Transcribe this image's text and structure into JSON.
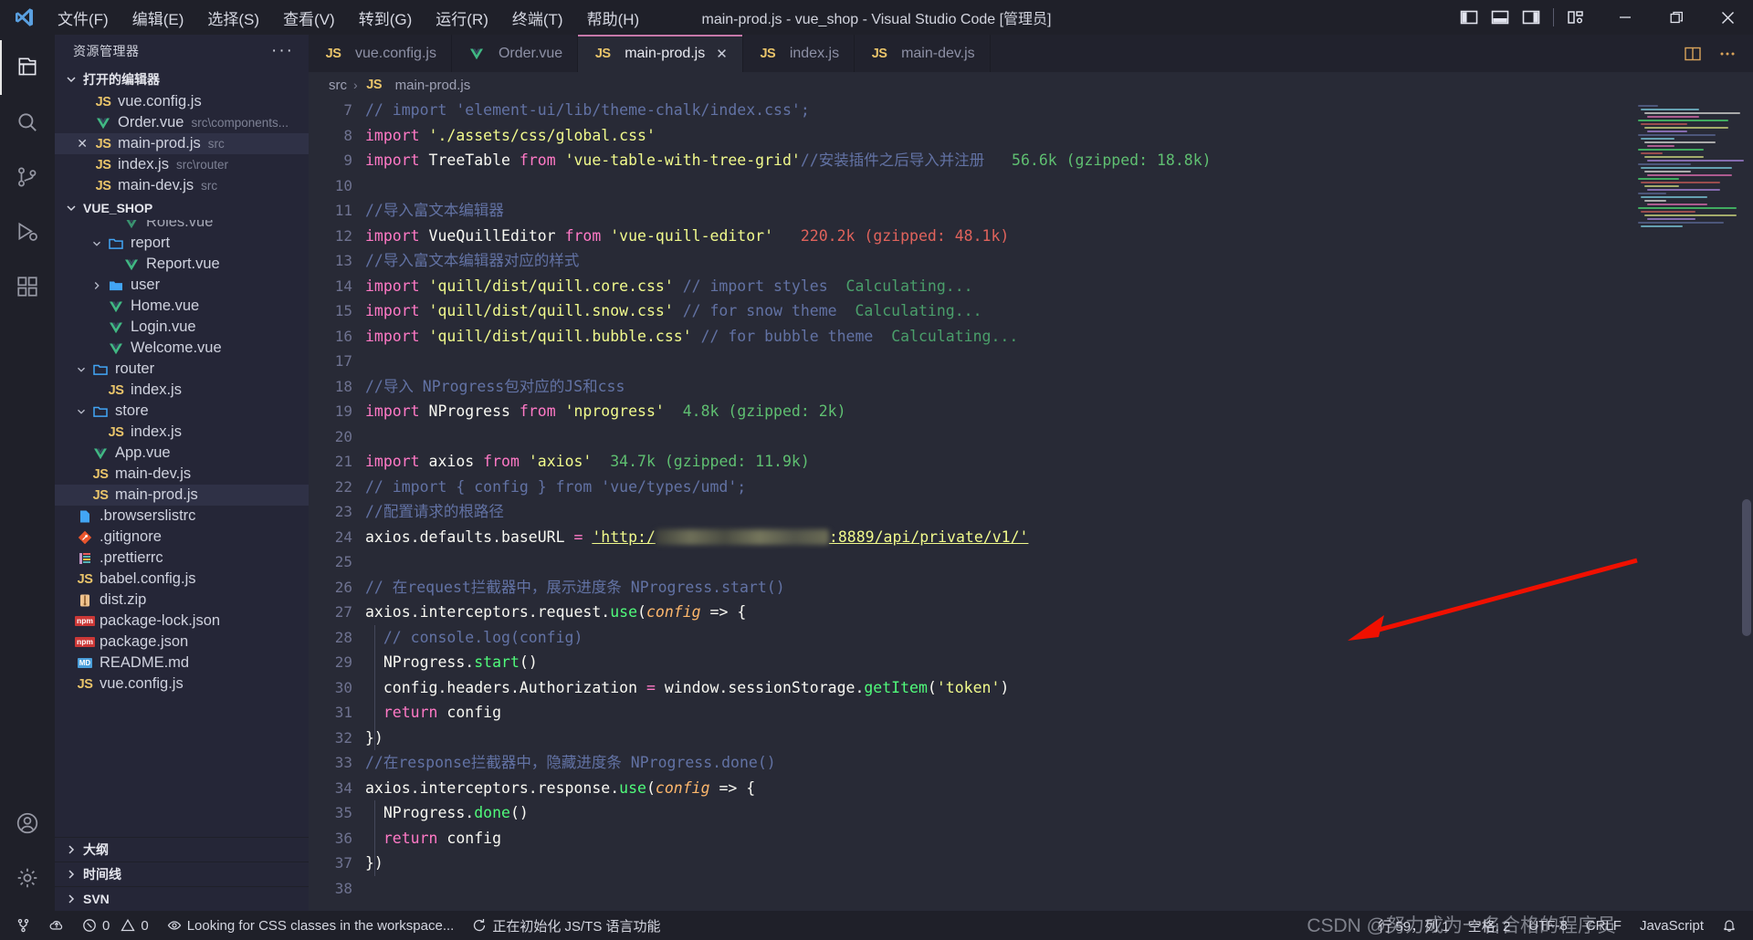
{
  "window": {
    "title": "main-prod.js - vue_shop - Visual Studio Code [管理员]",
    "minimize": "−",
    "maximize": "❐",
    "close": "✕"
  },
  "menu": [
    {
      "label": "文件(F)",
      "name": "menu-file"
    },
    {
      "label": "编辑(E)",
      "name": "menu-edit"
    },
    {
      "label": "选择(S)",
      "name": "menu-selection"
    },
    {
      "label": "查看(V)",
      "name": "menu-view"
    },
    {
      "label": "转到(G)",
      "name": "menu-go"
    },
    {
      "label": "运行(R)",
      "name": "menu-run"
    },
    {
      "label": "终端(T)",
      "name": "menu-terminal"
    },
    {
      "label": "帮助(H)",
      "name": "menu-help"
    }
  ],
  "activity_bar": [
    {
      "name": "explorer-icon",
      "active": true
    },
    {
      "name": "search-icon",
      "active": false
    },
    {
      "name": "source-control-icon",
      "active": false
    },
    {
      "name": "run-debug-icon",
      "active": false
    },
    {
      "name": "extensions-icon",
      "active": false
    },
    {
      "name": "account-icon",
      "active": false
    },
    {
      "name": "settings-gear-icon",
      "active": false
    }
  ],
  "sidebar": {
    "title": "资源管理器",
    "more_actions": "···",
    "open_editors": {
      "label": "打开的编辑器",
      "items": [
        {
          "icon": "js-icon",
          "name": "vue.config.js",
          "desc": "",
          "selected": false,
          "dirty": false
        },
        {
          "icon": "vue-icon",
          "name": "Order.vue",
          "desc": "src\\components...",
          "selected": false,
          "dirty": false
        },
        {
          "icon": "js-icon",
          "name": "main-prod.js",
          "desc": "src",
          "selected": true,
          "dirty": true
        },
        {
          "icon": "js-icon",
          "name": "index.js",
          "desc": "src\\router",
          "selected": false,
          "dirty": false
        },
        {
          "icon": "js-icon",
          "name": "main-dev.js",
          "desc": "src",
          "selected": false,
          "dirty": false
        }
      ]
    },
    "project": {
      "label": "VUE_SHOP",
      "items": [
        {
          "icon": "vue-icon",
          "name": "Roles.vue",
          "indent": 3,
          "selected": false,
          "clipped": true
        },
        {
          "icon": "folder-open-icon",
          "name": "report",
          "indent": 2,
          "expanded": true
        },
        {
          "icon": "vue-icon",
          "name": "Report.vue",
          "indent": 3
        },
        {
          "icon": "folder-icon",
          "name": "user",
          "indent": 2,
          "expanded": false
        },
        {
          "icon": "vue-icon",
          "name": "Home.vue",
          "indent": 2
        },
        {
          "icon": "vue-icon",
          "name": "Login.vue",
          "indent": 2
        },
        {
          "icon": "vue-icon",
          "name": "Welcome.vue",
          "indent": 2
        },
        {
          "icon": "folder-open-icon",
          "name": "router",
          "indent": 1,
          "expanded": true
        },
        {
          "icon": "js-icon",
          "name": "index.js",
          "indent": 2
        },
        {
          "icon": "folder-open-icon",
          "name": "store",
          "indent": 1,
          "expanded": true
        },
        {
          "icon": "js-icon",
          "name": "index.js",
          "indent": 2
        },
        {
          "icon": "vue-icon",
          "name": "App.vue",
          "indent": 1
        },
        {
          "icon": "js-icon",
          "name": "main-dev.js",
          "indent": 1
        },
        {
          "icon": "js-icon",
          "name": "main-prod.js",
          "indent": 1,
          "selected": true
        },
        {
          "icon": "file-blue-icon",
          "name": ".browserslistrc",
          "indent": 0
        },
        {
          "icon": "git-icon",
          "name": ".gitignore",
          "indent": 0
        },
        {
          "icon": "prettier-icon",
          "name": ".prettierrc",
          "indent": 0
        },
        {
          "icon": "js-icon",
          "name": "babel.config.js",
          "indent": 0
        },
        {
          "icon": "zip-icon",
          "name": "dist.zip",
          "indent": 0
        },
        {
          "icon": "npm-icon",
          "name": "package-lock.json",
          "indent": 0
        },
        {
          "icon": "npm-icon",
          "name": "package.json",
          "indent": 0
        },
        {
          "icon": "md-icon",
          "name": "README.md",
          "indent": 0
        },
        {
          "icon": "js-icon",
          "name": "vue.config.js",
          "indent": 0
        }
      ]
    },
    "bottom_sections": [
      {
        "label": "大纲",
        "name": "outline"
      },
      {
        "label": "时间线",
        "name": "timeline"
      },
      {
        "label": "SVN",
        "name": "svn"
      }
    ]
  },
  "tabs": [
    {
      "icon": "js-icon",
      "label": "vue.config.js",
      "active": false,
      "close": "✕"
    },
    {
      "icon": "vue-icon",
      "label": "Order.vue",
      "active": false,
      "close": "✕"
    },
    {
      "icon": "js-icon",
      "label": "main-prod.js",
      "active": true,
      "close": "✕"
    },
    {
      "icon": "js-icon",
      "label": "index.js",
      "active": false,
      "close": "✕"
    },
    {
      "icon": "js-icon",
      "label": "main-dev.js",
      "active": false,
      "close": "✕"
    }
  ],
  "breadcrumb": {
    "root": "src",
    "separator": "›",
    "file": "main-prod.js"
  },
  "editor": {
    "first_line": 7,
    "lines": [
      {
        "n": 7,
        "tokens": [
          {
            "t": "// import 'element-ui/lib/theme-chalk/index.css';",
            "c": "c"
          }
        ]
      },
      {
        "n": 8,
        "tokens": [
          {
            "t": "import ",
            "c": "k"
          },
          {
            "t": "'./assets/css/global.css'",
            "c": "s"
          }
        ]
      },
      {
        "n": 9,
        "tokens": [
          {
            "t": "import ",
            "c": "k"
          },
          {
            "t": "TreeTable ",
            "c": "v"
          },
          {
            "t": "from ",
            "c": "k"
          },
          {
            "t": "'vue-table-with-tree-grid'",
            "c": "s"
          },
          {
            "t": "//安装插件之后导入并注册",
            "c": "c"
          },
          {
            "t": "   56.6k (gzipped: 18.8k)",
            "c": "sz-g"
          }
        ]
      },
      {
        "n": 10,
        "tokens": []
      },
      {
        "n": 11,
        "tokens": [
          {
            "t": "//导入富文本编辑器",
            "c": "c"
          }
        ]
      },
      {
        "n": 12,
        "tokens": [
          {
            "t": "import ",
            "c": "k"
          },
          {
            "t": "VueQuillEditor ",
            "c": "v"
          },
          {
            "t": "from ",
            "c": "k"
          },
          {
            "t": "'vue-quill-editor'",
            "c": "s"
          },
          {
            "t": "   220.2k (gzipped: 48.1k)",
            "c": "sz-r"
          }
        ]
      },
      {
        "n": 13,
        "tokens": [
          {
            "t": "//导入富文本编辑器对应的样式",
            "c": "c"
          }
        ]
      },
      {
        "n": 14,
        "tokens": [
          {
            "t": "import ",
            "c": "k"
          },
          {
            "t": "'quill/dist/quill.core.css'",
            "c": "s"
          },
          {
            "t": " // import styles",
            "c": "c"
          },
          {
            "t": "  Calculating...",
            "c": "calc"
          }
        ]
      },
      {
        "n": 15,
        "tokens": [
          {
            "t": "import ",
            "c": "k"
          },
          {
            "t": "'quill/dist/quill.snow.css'",
            "c": "s"
          },
          {
            "t": " // for snow theme",
            "c": "c"
          },
          {
            "t": "  Calculating...",
            "c": "calc"
          }
        ]
      },
      {
        "n": 16,
        "tokens": [
          {
            "t": "import ",
            "c": "k"
          },
          {
            "t": "'quill/dist/quill.bubble.css'",
            "c": "s"
          },
          {
            "t": " // for bubble theme",
            "c": "c"
          },
          {
            "t": "  Calculating...",
            "c": "calc"
          }
        ]
      },
      {
        "n": 17,
        "tokens": []
      },
      {
        "n": 18,
        "tokens": [
          {
            "t": "//导入 NProgress包对应的JS和css",
            "c": "c"
          }
        ]
      },
      {
        "n": 19,
        "tokens": [
          {
            "t": "import ",
            "c": "k"
          },
          {
            "t": "NProgress ",
            "c": "v"
          },
          {
            "t": "from ",
            "c": "k"
          },
          {
            "t": "'nprogress'",
            "c": "s"
          },
          {
            "t": "  4.8k (gzipped: 2k)",
            "c": "sz-g"
          }
        ]
      },
      {
        "n": 20,
        "tokens": []
      },
      {
        "n": 21,
        "tokens": [
          {
            "t": "import ",
            "c": "k"
          },
          {
            "t": "axios ",
            "c": "v"
          },
          {
            "t": "from ",
            "c": "k"
          },
          {
            "t": "'axios'",
            "c": "s"
          },
          {
            "t": "  34.7k (gzipped: 11.9k)",
            "c": "sz-g"
          }
        ]
      },
      {
        "n": 22,
        "tokens": [
          {
            "t": "// import { config } from 'vue/types/umd';",
            "c": "c"
          }
        ]
      },
      {
        "n": 23,
        "tokens": [
          {
            "t": "//配置请求的根路径",
            "c": "c"
          }
        ]
      },
      {
        "n": 24,
        "tokens": [
          {
            "t": "axios.defaults.baseURL ",
            "c": "v"
          },
          {
            "t": "= ",
            "c": "k"
          },
          {
            "t": "'http:/",
            "c": "url"
          },
          {
            "t": "__BLUR__",
            "c": "blur"
          },
          {
            "t": ":8889/api/private/v1/'",
            "c": "url"
          }
        ]
      },
      {
        "n": 25,
        "tokens": []
      },
      {
        "n": 26,
        "tokens": [
          {
            "t": "// 在request拦截器中，展示进度条 NProgress.start()",
            "c": "c"
          }
        ]
      },
      {
        "n": 27,
        "tokens": [
          {
            "t": "axios.interceptors.request.",
            "c": "v"
          },
          {
            "t": "use",
            "c": "fn"
          },
          {
            "t": "(",
            "c": "v"
          },
          {
            "t": "config",
            "c": "par"
          },
          {
            "t": " => {",
            "c": "v"
          }
        ]
      },
      {
        "n": 28,
        "tokens": [
          {
            "t": "  // console.log(config)",
            "c": "c"
          }
        ]
      },
      {
        "n": 29,
        "tokens": [
          {
            "t": "  NProgress.",
            "c": "v"
          },
          {
            "t": "start",
            "c": "fn"
          },
          {
            "t": "()",
            "c": "v"
          }
        ]
      },
      {
        "n": 30,
        "tokens": [
          {
            "t": "  config.headers.Authorization ",
            "c": "v"
          },
          {
            "t": "= ",
            "c": "k"
          },
          {
            "t": "window.sessionStorage.",
            "c": "v"
          },
          {
            "t": "getItem",
            "c": "fn"
          },
          {
            "t": "(",
            "c": "v"
          },
          {
            "t": "'token'",
            "c": "s"
          },
          {
            "t": ")",
            "c": "v"
          }
        ]
      },
      {
        "n": 31,
        "tokens": [
          {
            "t": "  return",
            "c": "k"
          },
          {
            "t": " config",
            "c": "v"
          }
        ]
      },
      {
        "n": 32,
        "tokens": [
          {
            "t": "})",
            "c": "v"
          }
        ]
      },
      {
        "n": 33,
        "tokens": [
          {
            "t": "//在response拦截器中，隐藏进度条 NProgress.done()",
            "c": "c"
          }
        ]
      },
      {
        "n": 34,
        "tokens": [
          {
            "t": "axios.interceptors.response.",
            "c": "v"
          },
          {
            "t": "use",
            "c": "fn"
          },
          {
            "t": "(",
            "c": "v"
          },
          {
            "t": "config",
            "c": "par"
          },
          {
            "t": " => {",
            "c": "v"
          }
        ]
      },
      {
        "n": 35,
        "tokens": [
          {
            "t": "  NProgress.",
            "c": "v"
          },
          {
            "t": "done",
            "c": "fn"
          },
          {
            "t": "()",
            "c": "v"
          }
        ]
      },
      {
        "n": 36,
        "tokens": [
          {
            "t": "  return",
            "c": "k"
          },
          {
            "t": " config",
            "c": "v"
          }
        ]
      },
      {
        "n": 37,
        "tokens": [
          {
            "t": "})",
            "c": "v"
          }
        ]
      },
      {
        "n": 38,
        "tokens": []
      }
    ]
  },
  "status_bar": {
    "left": [
      {
        "name": "remote-icon",
        "icon": "remote",
        "text": ""
      },
      {
        "name": "source-control-branch",
        "icon": "cloud",
        "text": ""
      },
      {
        "name": "problems",
        "icon": "errwarn",
        "errors": "0",
        "warnings": "0"
      },
      {
        "name": "css-classes-status",
        "icon": "eye",
        "text": "Looking for CSS classes in the workspace..."
      },
      {
        "name": "jsts-init-status",
        "icon": "sync",
        "text": "正在初始化 JS/TS 语言功能"
      }
    ],
    "right": [
      {
        "name": "cursor-position",
        "text": "行 59，列 1"
      },
      {
        "name": "indentation",
        "text": "空格: 2"
      },
      {
        "name": "encoding",
        "text": "UTF-8"
      },
      {
        "name": "eol",
        "text": "CRLF"
      },
      {
        "name": "language-mode",
        "text": "JavaScript"
      },
      {
        "name": "notifications",
        "text": "🔔"
      }
    ]
  },
  "watermark": "CSDN @努力成为一名合格的程序员",
  "colors": {
    "accent": "#c678a9",
    "editor_bg": "#282a36",
    "sidebar_bg": "#252637",
    "titlebar_bg": "#1f2029",
    "string": "#f1fa8c",
    "keyword": "#ff79c6",
    "comment": "#6272a4",
    "function": "#50fa7b",
    "size_green": "#5fbf71",
    "size_red": "#e0635c",
    "arrow_red": "#f01000"
  }
}
